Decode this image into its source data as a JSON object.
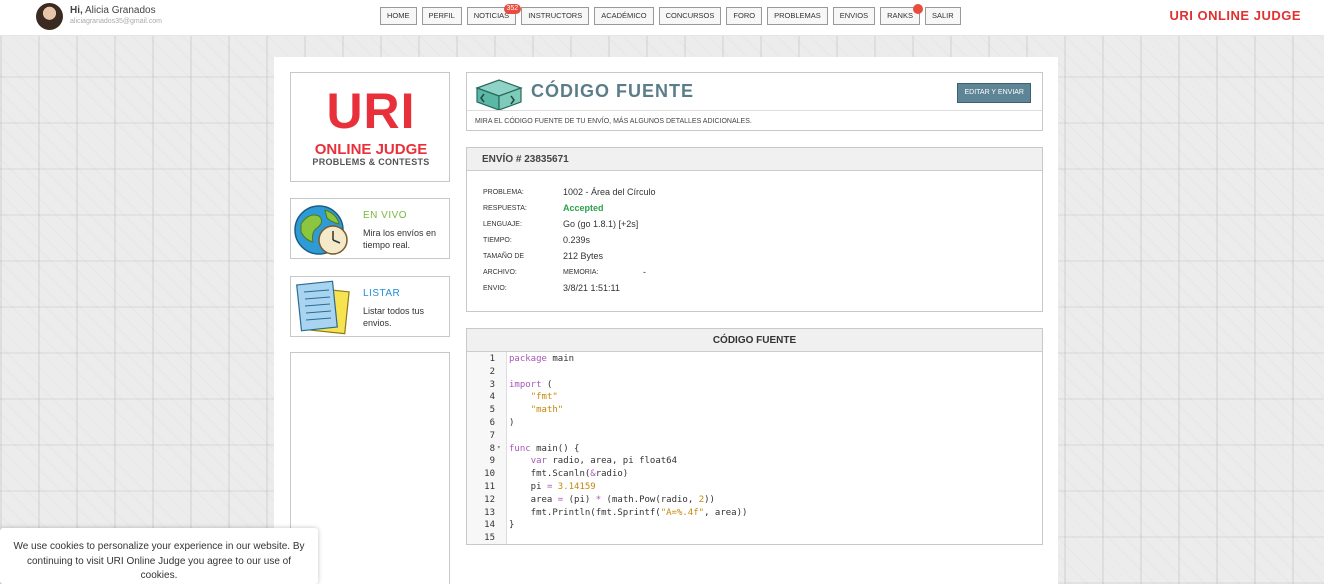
{
  "user": {
    "greeting": "Hi,",
    "name": "Alicia Granados",
    "email": "aliciagranados35@gmail.com"
  },
  "nav": {
    "items": [
      "HOME",
      "PERFIL",
      "NOTICIAS",
      "INSTRUCTORS",
      "ACADÉMICO",
      "CONCURSOS",
      "FORO",
      "PROBLEMAS",
      "ENVIOS",
      "RANKS",
      "SALIR"
    ],
    "notif_count": "352"
  },
  "brand": "URI ONLINE JUDGE",
  "logo": {
    "title": "URI",
    "sub1": "ONLINE JUDGE",
    "sub2": "PROBLEMS & CONTESTS"
  },
  "sidebar": {
    "live": {
      "title": "EN VIVO",
      "desc": "Mira los envíos en tiempo real."
    },
    "list": {
      "title": "LISTAR",
      "desc": "Listar todos tus envios."
    }
  },
  "header": {
    "title": "CÓDIGO FUENTE",
    "edit_label": "EDITAR Y ENVIAR",
    "description": "MIRA EL CÓDIGO FUENTE DE TU ENVÍO, MÁS ALGUNOS DETALLES ADICIONALES."
  },
  "submission": {
    "title": "ENVÍO # 23835671",
    "problem_label": "PROBLEMA:",
    "problem_value": "1002 - Área del Círculo",
    "response_label": "RESPUESTA:",
    "response_value": "Accepted",
    "language_label": "LENGUAJE:",
    "language_value": "Go (go 1.8.1) [+2s]",
    "time_label": "TIEMPO:",
    "time_value": "0.239s",
    "size_label": "TAMAÑO DE",
    "size_value": "212 Bytes",
    "file_label": "ARCHIVO:",
    "memory_label": "MEMORIA:",
    "memory_value": "-",
    "sent_label": "ENVIO:",
    "sent_value": "3/8/21 1:51:11"
  },
  "code": {
    "title": "CÓDIGO FUENTE",
    "line_numbers": [
      "1",
      "2",
      "3",
      "4",
      "5",
      "6",
      "7",
      "8",
      "9",
      "10",
      "11",
      "12",
      "13",
      "14",
      "15"
    ],
    "lines": [
      "package main",
      "",
      "import (",
      "    \"fmt\"",
      "    \"math\"",
      ")",
      "",
      "func main() {",
      "    var radio, area, pi float64",
      "    fmt.Scanln(&radio)",
      "    pi = 3.14159",
      "    area = (pi) * (math.Pow(radio, 2))",
      "    fmt.Println(fmt.Sprintf(\"A=%.4f\", area))",
      "}",
      ""
    ]
  },
  "cookie": {
    "text": "We use cookies to personalize your experience in our website. By continuing to visit URI Online Judge you agree to our use of cookies."
  },
  "colors": {
    "brand_red": "#e0302f",
    "accent_green": "#7ab83a",
    "accent_blue": "#1f8fd6",
    "accepted_green": "#2ba34a",
    "header_teal": "#5b7d8a"
  }
}
